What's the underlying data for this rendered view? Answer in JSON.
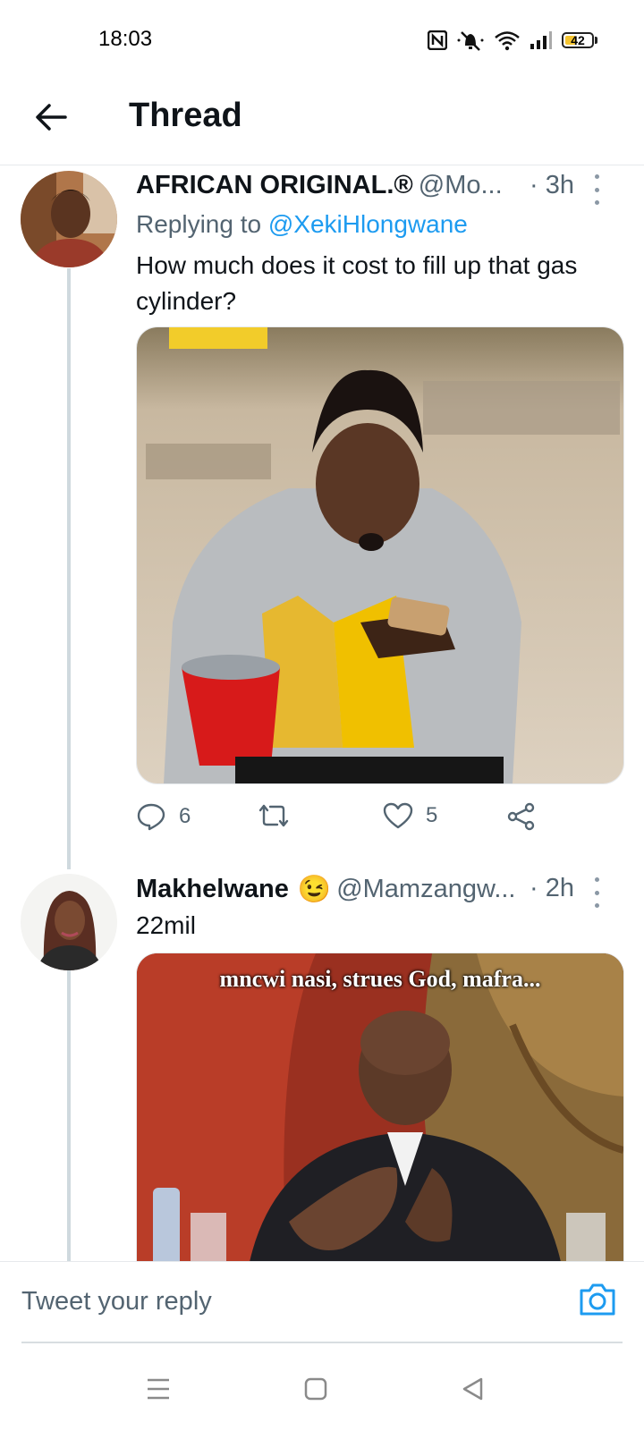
{
  "status_bar": {
    "time": "18:03",
    "battery": "42",
    "battery_level": 0.42
  },
  "header": {
    "title": "Thread",
    "back_icon": "arrow-left-icon"
  },
  "tweets": [
    {
      "name": "AFRICAN ORIGINAL.®",
      "handle": "@Mo...",
      "time": "· 3h",
      "replying_prefix": "Replying to ",
      "replying_to": "@XekiHlongwane",
      "text": "How much does it cost to fill up that gas cylinder?",
      "actions": {
        "replies": "6",
        "likes": "5"
      }
    },
    {
      "name": "Makhelwane",
      "emoji": "😉",
      "handle": "@Mamzangw...",
      "time": "· 2h",
      "text": "22mil",
      "meme_caption": "mncwi nasi, strues God, mafra..."
    }
  ],
  "reply_bar": {
    "placeholder": "Tweet your reply"
  },
  "colors": {
    "accent": "#1d9bf0",
    "text": "#0f1419",
    "muted": "#536471",
    "divider": "#e6e9ec"
  }
}
